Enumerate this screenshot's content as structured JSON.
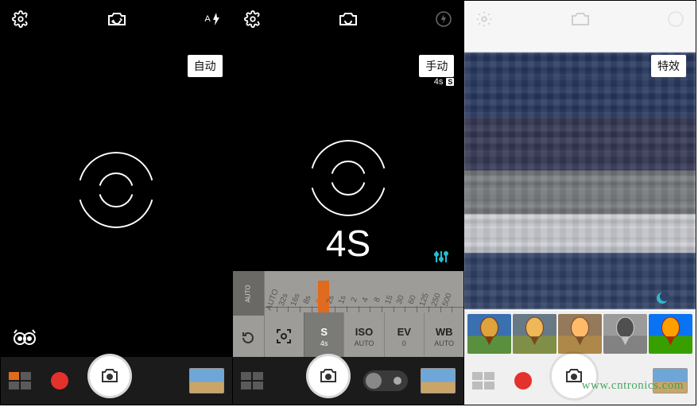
{
  "watermark": "www.cntronics.com",
  "panels": {
    "p1": {
      "mode_label": "自动",
      "flash_text": "A",
      "bottom": {
        "has_record": true
      }
    },
    "p2": {
      "mode_label": "手动",
      "sub_left": "4s",
      "sub_badge": "S",
      "shutter_display": "4S",
      "scale": {
        "labels": [
          "AUTO",
          "32s",
          "16s",
          "8s",
          "4s",
          "2s",
          "1s",
          "2",
          "4",
          "8",
          "15",
          "30",
          "60",
          "125",
          "250",
          "500"
        ],
        "selected_index": 4
      },
      "left_col": {
        "top": "AUTO",
        "reset": "↻"
      },
      "params": [
        {
          "key": "focus",
          "icon": "focus",
          "value": "",
          "sub": ""
        },
        {
          "key": "shutter",
          "icon": "",
          "value": "S",
          "sub": "4s",
          "active": true
        },
        {
          "key": "iso",
          "icon": "",
          "value": "ISO",
          "sub": "AUTO"
        },
        {
          "key": "ev",
          "icon": "",
          "value": "EV",
          "sub": "0"
        },
        {
          "key": "wb",
          "icon": "",
          "value": "WB",
          "sub": "AUTO"
        }
      ]
    },
    "p3": {
      "mode_label": "特效",
      "filters": [
        {
          "name": "normal",
          "selected": false
        },
        {
          "name": "warm",
          "selected": true
        },
        {
          "name": "yellow",
          "selected": false
        },
        {
          "name": "sketch",
          "selected": false
        },
        {
          "name": "vivid",
          "selected": false
        }
      ]
    }
  }
}
